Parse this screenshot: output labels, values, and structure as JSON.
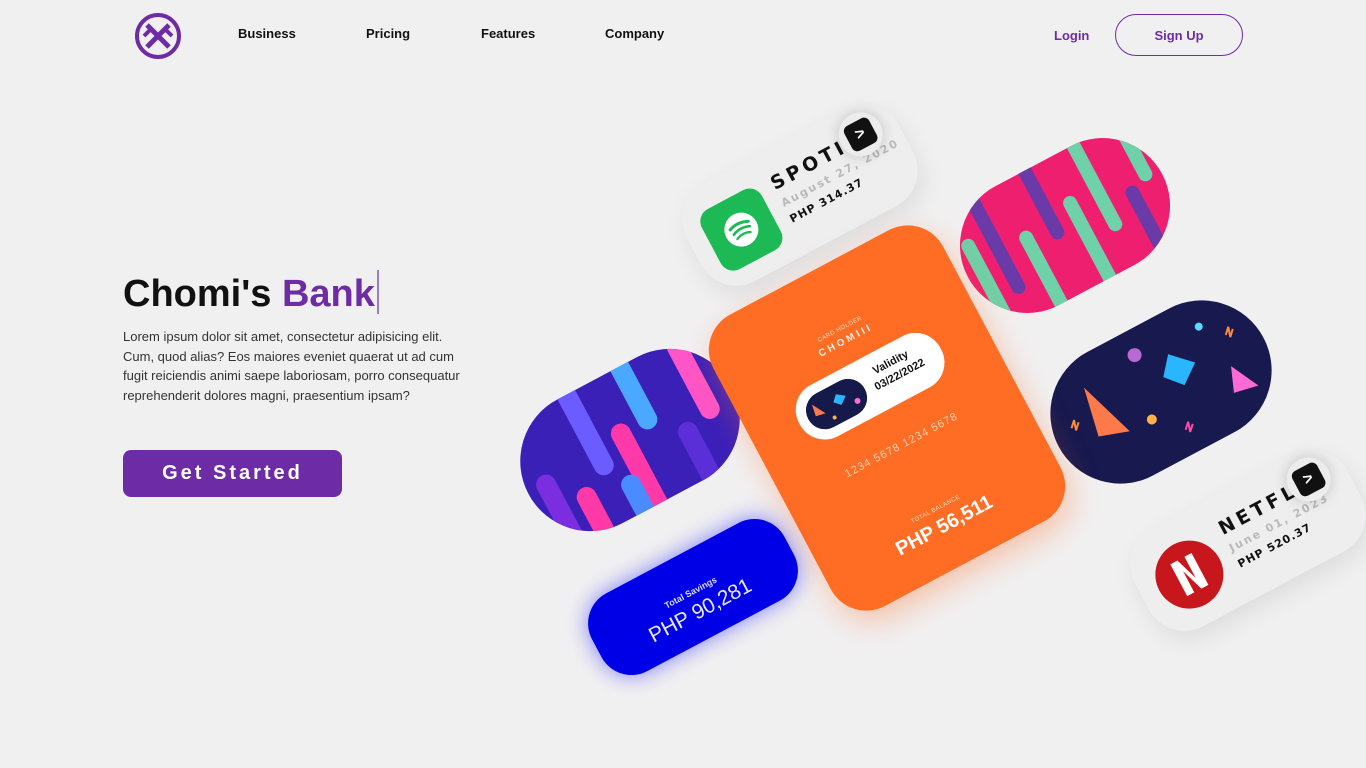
{
  "brand": {
    "logo_icon": "brand-x-logo-icon",
    "color": "#6d2ca6"
  },
  "nav": {
    "links": [
      "Business",
      "Pricing",
      "Features",
      "Company"
    ],
    "login": "Login",
    "signup": "Sign Up"
  },
  "hero": {
    "title_part1": "Chomi's",
    "title_part2": "Bank",
    "description": "Lorem ipsum dolor sit amet, consectetur adipisicing elit. Cum, quod alias? Eos maiores eveniet quaerat ut ad cum fugit reiciendis animi saepe laboriosam, porro consequatur reprehenderit dolores magni, praesentium ipsam?",
    "cta": "Get Started"
  },
  "cards": {
    "spotify": {
      "name": "SPOTIFY",
      "date": "August 27, 2020",
      "amount": "PHP 314.37",
      "icon": "spotify-icon",
      "color": "#1db954"
    },
    "netflix": {
      "name": "NETFLIX",
      "date": "June 01, 2023",
      "amount": "PHP 520.37",
      "icon": "netflix-icon",
      "color": "#c8161d"
    },
    "bank_card": {
      "holder_label": "CARD HOLDER",
      "holder": "CHOMIII",
      "validity_label": "Validity",
      "validity": "03/22/2022",
      "number": "1234 5678 1234 5678",
      "balance_label": "TOTAL BALANCE",
      "balance": "PHP 56,511",
      "color": "#ff6d24"
    },
    "savings": {
      "label": "Total Savings",
      "value": "PHP 90,281",
      "color": "#0000e6"
    }
  }
}
